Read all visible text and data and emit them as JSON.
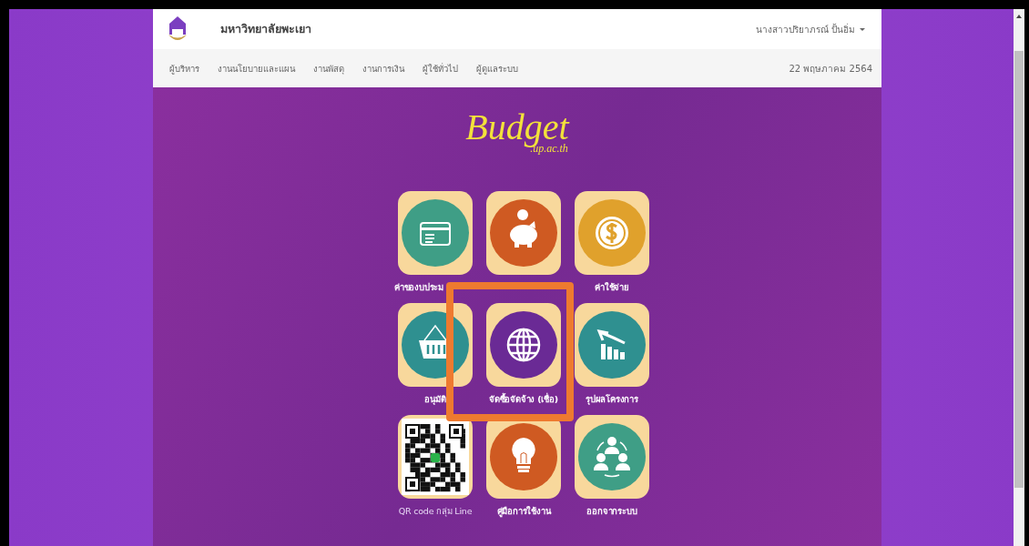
{
  "header": {
    "site_title": "มหาวิทยาลัยพะเยา",
    "user_menu": "นางสาวปริยาภรณ์ ปั้นอิ่ม"
  },
  "nav": {
    "items": [
      {
        "label": "ผู้บริหาร"
      },
      {
        "label": "งานนโยบายและแผน"
      },
      {
        "label": "งานพัสดุ"
      },
      {
        "label": "งานการเงิน"
      },
      {
        "label": "ผู้ใช้ทั่วไป"
      },
      {
        "label": "ผู้ดูแลระบบ"
      }
    ],
    "date": "22 พฤษภาคม 2564"
  },
  "logo": {
    "title": "Budget",
    "subtitle": ".up.ac.th"
  },
  "tiles": [
    {
      "kind": "card",
      "color": "#3f9e86",
      "label": "ค่าของบประม"
    },
    {
      "kind": "piggy",
      "color": "#cf5a22"
    },
    {
      "kind": "coin",
      "color": "#e0a12c",
      "label": "ค่าใช้จ่าย"
    },
    {
      "kind": "basket",
      "color": "#2f9090",
      "label": "อนุมัติ"
    },
    {
      "kind": "globe",
      "color": "#6a2a95",
      "label": "จัดซื้อจัดจ้าง (เชื่อ)"
    },
    {
      "kind": "chart",
      "color": "#2f9090",
      "label": "รุปผลโครงการ"
    },
    {
      "kind": "qr",
      "label": "QR code กลุ่ม Line"
    },
    {
      "kind": "bulb",
      "color": "#cf5a22",
      "label": "คู่มือการใช้งาน"
    },
    {
      "kind": "people",
      "color": "#3f9e86",
      "label": "ออกจากระบบ"
    }
  ]
}
